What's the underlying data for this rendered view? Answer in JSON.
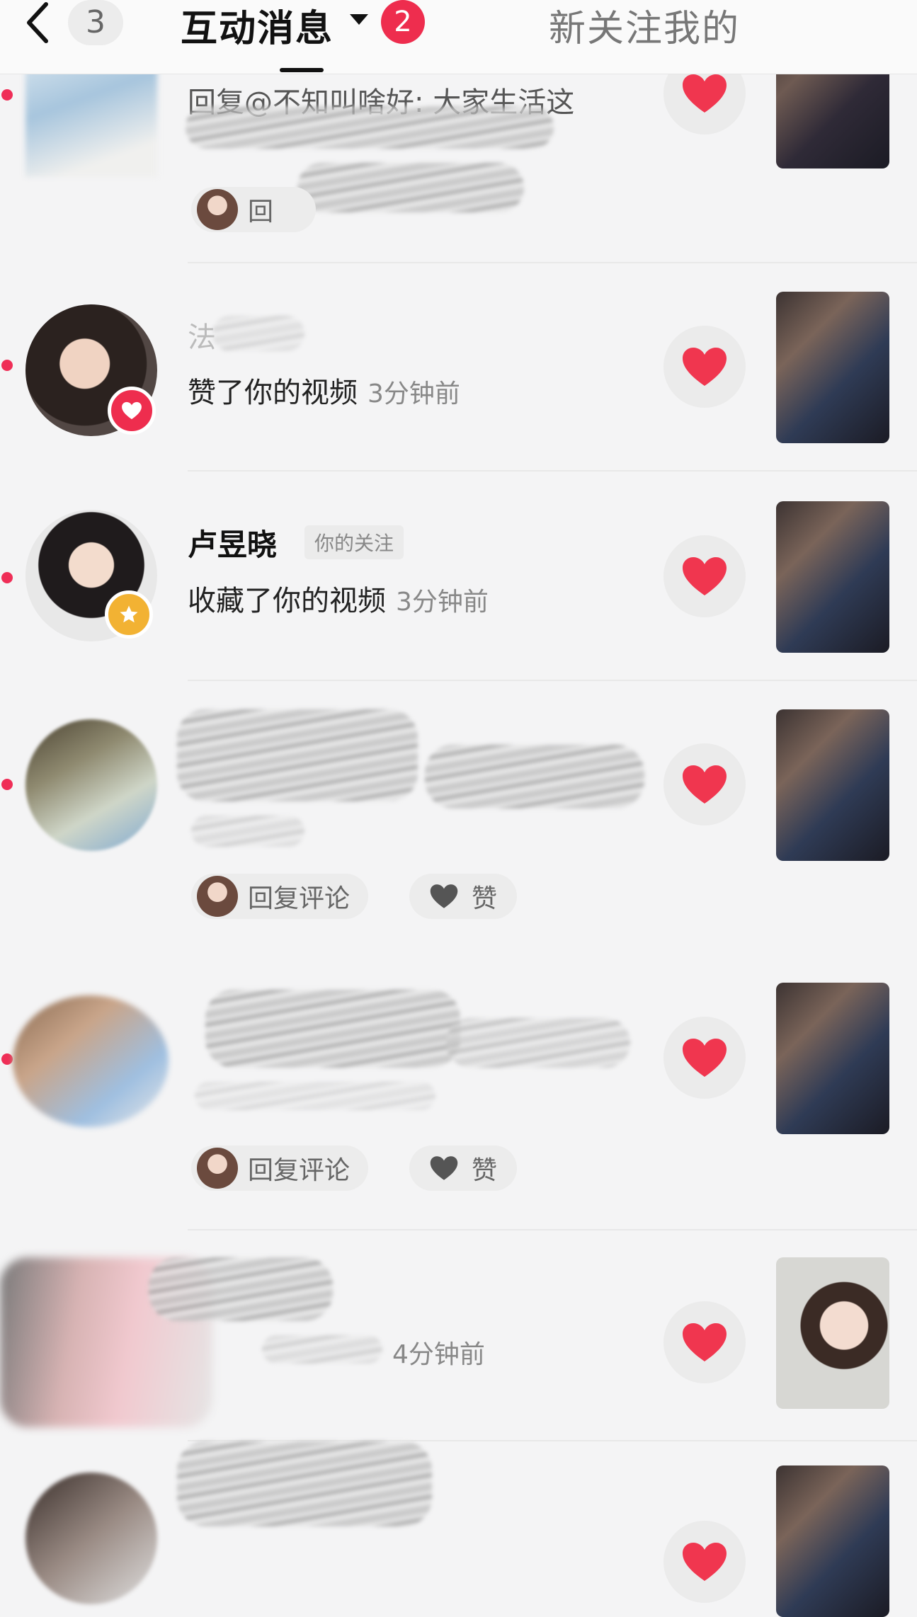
{
  "header": {
    "back_count": "3",
    "title": "互动消息",
    "badge": "2",
    "right_tab": "新关注我的"
  },
  "rows": [
    {
      "partial_text": "回复@不知叫啥好: 大家生活这",
      "reply_label": "回"
    },
    {
      "name_faded": "法",
      "action": "赞了你的视频",
      "time": "3分钟前"
    },
    {
      "name": "卢昱晓",
      "tag": "你的关注",
      "action": "收藏了你的视频",
      "time": "3分钟前"
    },
    {
      "reply_label": "回复评论",
      "like_label": "赞"
    },
    {
      "reply_label": "回复评论",
      "like_label": "赞"
    },
    {
      "time": "4分钟前"
    }
  ],
  "colors": {
    "accent": "#ee2d4e",
    "heart": "#f0364f",
    "star_badge": "#f2b233"
  }
}
